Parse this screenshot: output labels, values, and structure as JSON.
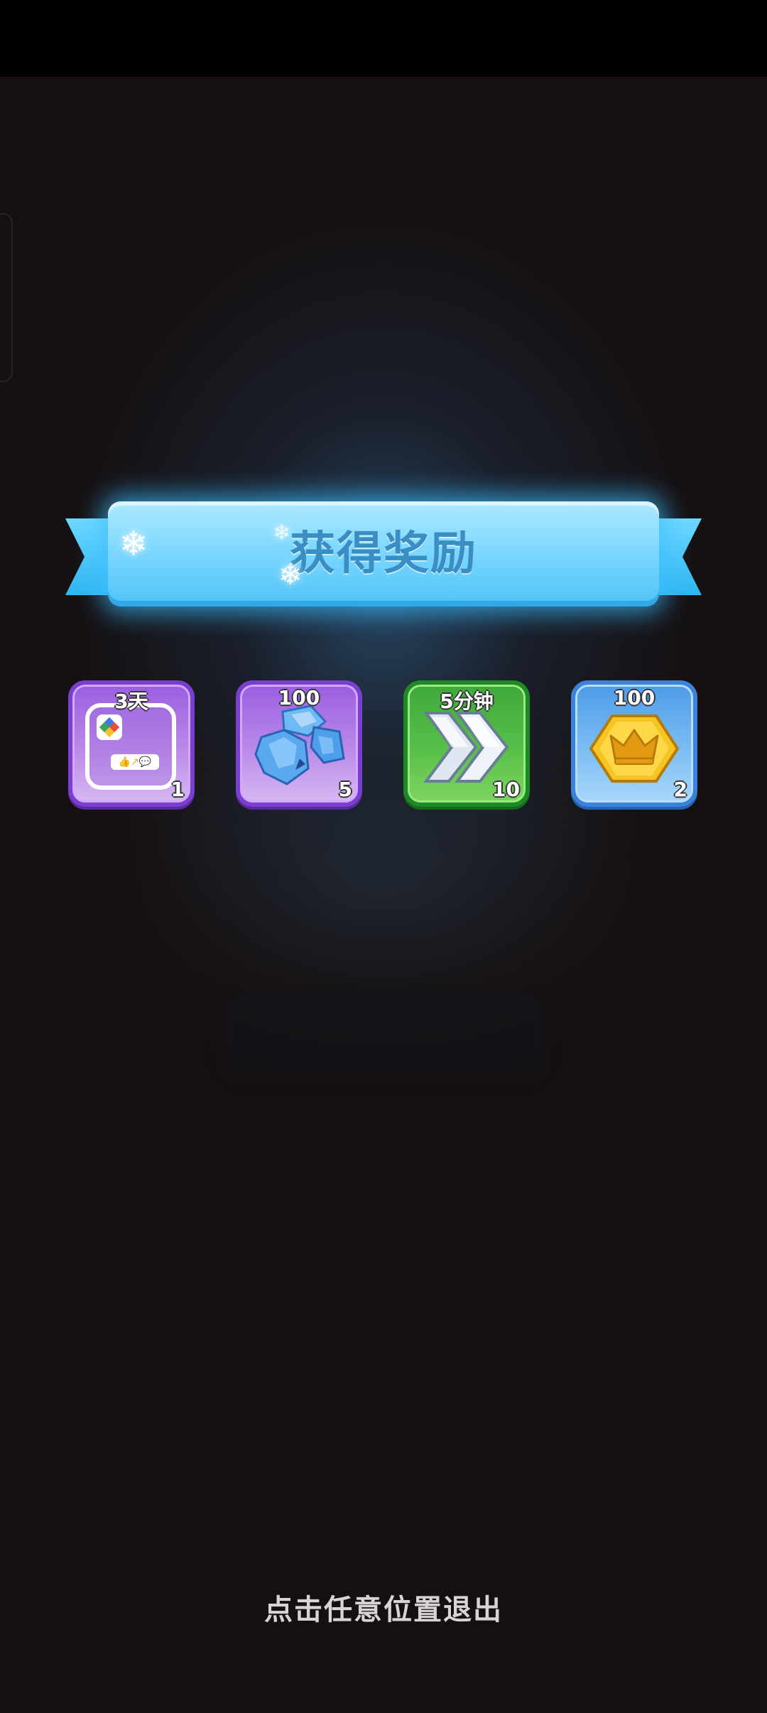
{
  "banner": {
    "title": "获得奖励"
  },
  "rewards": [
    {
      "top_label": "3天",
      "count": "1",
      "icon": "avatar-frame-icon",
      "theme": "purple"
    },
    {
      "top_label": "100",
      "count": "5",
      "icon": "blue-gem-icon",
      "theme": "purple"
    },
    {
      "top_label": "5分钟",
      "count": "10",
      "icon": "speedup-arrows-icon",
      "theme": "green"
    },
    {
      "top_label": "100",
      "count": "2",
      "icon": "gold-crown-hexagon-icon",
      "theme": "blue"
    }
  ],
  "footer": {
    "exit_hint": "点击任意位置退出"
  },
  "colors": {
    "background": "#150f10",
    "banner_blue": "#7fd8ff",
    "banner_text": "#3a8ec4",
    "purple_border": "#7a3fcf",
    "green_border": "#1f8a25",
    "blue_border": "#3a82db"
  }
}
